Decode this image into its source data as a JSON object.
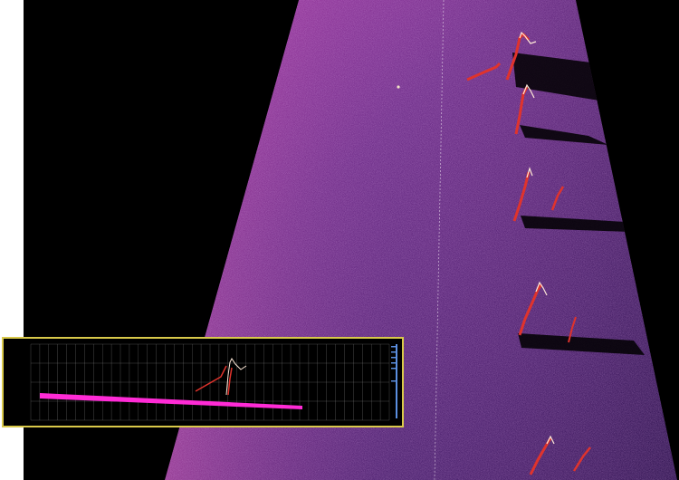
{
  "image": {
    "description_free": true,
    "colors": {
      "background": "#000000",
      "swath_low": "#3a1c5e",
      "swath_mid": "#7a2f8c",
      "swath_high": "#b23aa8",
      "target_red": "#e0332c",
      "target_white": "#ffe9d8",
      "inset_border": "#d9c94a",
      "inset_grid": "#9a9a9a",
      "inset_trace": "#ff2bd6"
    },
    "icons": []
  },
  "inset": {
    "y_ticks": [
      "",
      "",
      "",
      ""
    ],
    "x_ticks": [
      "",
      "",
      "",
      "",
      "",
      "",
      "",
      "",
      "",
      "",
      "",
      "",
      "",
      "",
      "",
      "",
      "",
      "",
      "",
      "",
      "",
      "",
      "",
      "",
      "",
      "",
      "",
      "",
      "",
      "",
      "",
      "",
      "",
      "",
      "",
      "",
      "",
      "",
      "",
      ""
    ]
  }
}
